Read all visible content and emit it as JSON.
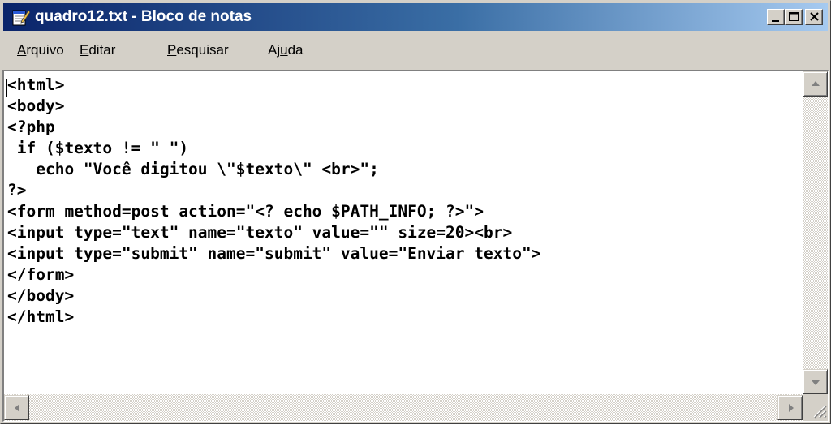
{
  "window": {
    "title": "quadro12.txt - Bloco de notas",
    "app_icon": "notepad-icon",
    "controls": {
      "minimize_icon": "minimize-icon",
      "maximize_icon": "maximize-icon",
      "close_icon": "close-icon"
    },
    "colors": {
      "title_start": "#0a246a",
      "title_end": "#a6caf0",
      "chrome": "#d4d0c8"
    }
  },
  "menubar": {
    "items": [
      {
        "label": "Arquivo",
        "accel": "A"
      },
      {
        "label": "Editar",
        "accel": "E"
      },
      {
        "label": "Pesquisar",
        "accel": "P"
      },
      {
        "label": "Ajuda",
        "accel": "u"
      }
    ]
  },
  "editor": {
    "lines": [
      "<html>",
      "<body>",
      "<?php",
      " if ($texto != \" \")",
      "   echo \"Você digitou \\\"$texto\\\" <br>\";",
      "?>",
      "<form method=post action=\"<? echo $PATH_INFO; ?>\">",
      "<input type=\"text\" name=\"texto\" value=\"\" size=20><br>",
      "<input type=\"submit\" name=\"submit\" value=\"Enviar texto\">",
      "</form>",
      "</body>",
      "</html>"
    ]
  },
  "scrollbars": {
    "up_icon": "scroll-up-arrow-icon",
    "down_icon": "scroll-down-arrow-icon",
    "left_icon": "scroll-left-arrow-icon",
    "right_icon": "scroll-right-arrow-icon"
  }
}
